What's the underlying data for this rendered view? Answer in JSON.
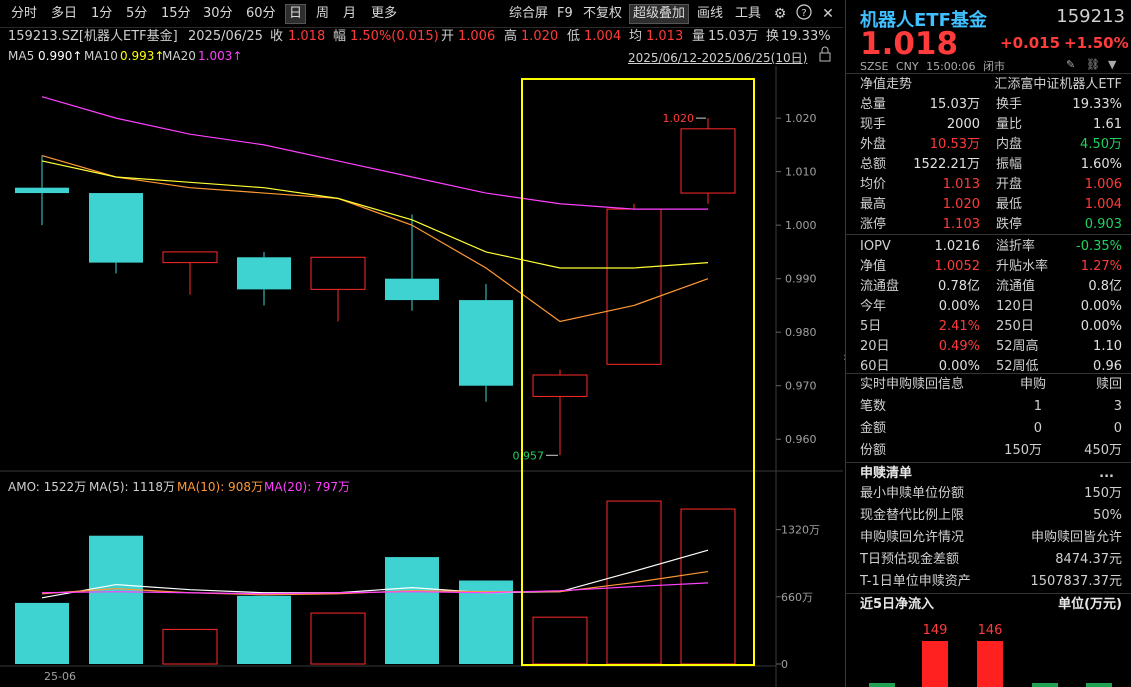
{
  "toolbar": {
    "periods": [
      "分时",
      "多日",
      "1分",
      "5分",
      "15分",
      "30分",
      "60分",
      "日",
      "周",
      "月",
      "更多"
    ],
    "active_period": "日",
    "right_items": [
      "综合屏",
      "F9",
      "不复权",
      "超级叠加",
      "画线",
      "工具"
    ]
  },
  "info": {
    "code_name": "159213.SZ[机器人ETF基金]",
    "date": "2025/06/25",
    "close_label": "收",
    "close": "1.018",
    "change_label": "幅",
    "change": "1.50%(0.015)",
    "open_label": "开",
    "open": "1.006",
    "high_label": "高",
    "high": "1.020",
    "low_label": "低",
    "low": "1.004",
    "avg_label": "均",
    "avg": "1.013",
    "vol_label": "量",
    "vol": "15.03万",
    "turnover_label": "换",
    "turnover": "19.33%",
    "range_text": "2025/06/12-2025/06/25(10日)"
  },
  "ma": {
    "ma5": "MA5",
    "ma5_val": "0.990↑",
    "ma10": "MA10",
    "ma10_val": "0.993↑",
    "ma20": "MA20",
    "ma20_val": "1.003↑"
  },
  "amo": {
    "amo_text": "AMO: 1522万",
    "ma5_text": "MA(5): 1118万",
    "ma10_text": "MA(10): 908万",
    "ma20_text": "MA(20): 797万"
  },
  "chart_data": {
    "type": "candlestick",
    "x_label_first": "25-06",
    "y_ticks": [
      "1.020",
      "1.010",
      "1.000",
      "0.990",
      "0.980",
      "0.970",
      "0.960"
    ],
    "candles": [
      {
        "open": 1.006,
        "close": 1.007,
        "high": 1.013,
        "low": 1.0,
        "up": false
      },
      {
        "open": 1.006,
        "close": 0.993,
        "high": 1.006,
        "low": 0.991,
        "up": false
      },
      {
        "open": 0.993,
        "close": 0.995,
        "high": 0.995,
        "low": 0.987,
        "up": true
      },
      {
        "open": 0.994,
        "close": 0.988,
        "high": 0.995,
        "low": 0.985,
        "up": false
      },
      {
        "open": 0.988,
        "close": 0.994,
        "high": 0.994,
        "low": 0.982,
        "up": true
      },
      {
        "open": 0.99,
        "close": 0.986,
        "high": 1.002,
        "low": 0.984,
        "up": false
      },
      {
        "open": 0.986,
        "close": 0.97,
        "high": 0.989,
        "low": 0.967,
        "up": false
      },
      {
        "open": 0.968,
        "close": 0.972,
        "high": 0.973,
        "low": 0.957,
        "up": true
      },
      {
        "open": 0.974,
        "close": 1.003,
        "high": 1.004,
        "low": 0.974,
        "up": true
      },
      {
        "open": 1.006,
        "close": 1.018,
        "high": 1.02,
        "low": 1.004,
        "up": true
      }
    ],
    "ma5": [
      1.013,
      1.009,
      1.007,
      1.006,
      1.005,
      1.0,
      0.992,
      0.982,
      0.985,
      0.99
    ],
    "ma10": [
      1.012,
      1.009,
      1.008,
      1.007,
      1.005,
      1.001,
      0.995,
      0.992,
      0.992,
      0.993
    ],
    "ma20": [
      1.024,
      1.02,
      1.017,
      1.015,
      1.012,
      1.009,
      1.006,
      1.004,
      1.003,
      1.003
    ],
    "high_label": "1.020",
    "low_label": "0.957",
    "amount_ticks": [
      "1320万",
      "660万",
      "0"
    ],
    "amounts": [
      600,
      1260,
      340,
      670,
      500,
      1050,
      820,
      460,
      1600,
      1522
    ],
    "amounts_up": [
      false,
      false,
      true,
      false,
      true,
      false,
      false,
      true,
      true,
      true
    ],
    "amo_ma5": [
      650,
      780,
      730,
      700,
      700,
      750,
      700,
      710,
      910,
      1118
    ],
    "amo_ma10": [
      690,
      740,
      700,
      680,
      690,
      720,
      710,
      710,
      800,
      908
    ],
    "amo_ma20": [
      700,
      710,
      700,
      690,
      700,
      710,
      700,
      720,
      760,
      797
    ]
  },
  "right": {
    "name": "机器人ETF基金",
    "code": "159213",
    "price": "1.018",
    "change": "+0.015",
    "change_pct": "+1.50%",
    "market": "SZSE",
    "currency": "CNY",
    "time": "15:00:06",
    "status": "闭市",
    "trend_label": "净值走势",
    "fund_company": "汇添富中证机器人ETF",
    "stats": [
      [
        "总量",
        "15.03万",
        "换手",
        "19.33%"
      ],
      [
        "现手",
        "2000",
        "量比",
        "1.61"
      ],
      [
        "外盘",
        "10.53万",
        "内盘",
        "4.50万"
      ],
      [
        "总额",
        "1522.21万",
        "振幅",
        "1.60%"
      ],
      [
        "均价",
        "1.013",
        "开盘",
        "1.006"
      ],
      [
        "最高",
        "1.020",
        "最低",
        "1.004"
      ],
      [
        "涨停",
        "1.103",
        "跌停",
        "0.903"
      ],
      [
        "IOPV",
        "1.0216",
        "溢折率",
        "-0.35%"
      ],
      [
        "净值",
        "1.0052",
        "升贴水率",
        "1.27%"
      ],
      [
        "流通盘",
        "0.78亿",
        "流通值",
        "0.8亿"
      ],
      [
        "今年",
        "0.00%",
        "120日",
        "0.00%"
      ],
      [
        "5日",
        "2.41%",
        "250日",
        "0.00%"
      ],
      [
        "20日",
        "0.49%",
        "52周高",
        "1.10"
      ],
      [
        "60日",
        "0.00%",
        "52周低",
        "0.96"
      ]
    ],
    "subscribe_header": "实时申购赎回信息",
    "subscribe_col": "申购",
    "redeem_col": "赎回",
    "subscribe_rows": [
      [
        "笔数",
        "1",
        "3"
      ],
      [
        "金额",
        "0",
        "0"
      ],
      [
        "份额",
        "150万",
        "450万"
      ]
    ],
    "list_title": "申赎清单",
    "list_more": "...",
    "list_rows": [
      [
        "最小申赎单位份额",
        "150万"
      ],
      [
        "现金替代比例上限",
        "50%"
      ],
      [
        "申购赎回允许情况",
        "申购赎回皆允许"
      ],
      [
        "T日预估现金差额",
        "8474.37元"
      ],
      [
        "T-1日单位申赎资产",
        "1507837.37元"
      ]
    ],
    "flow_title": "近5日净流入",
    "flow_unit": "单位(万元)",
    "flow_values": [
      "149",
      "146"
    ]
  }
}
